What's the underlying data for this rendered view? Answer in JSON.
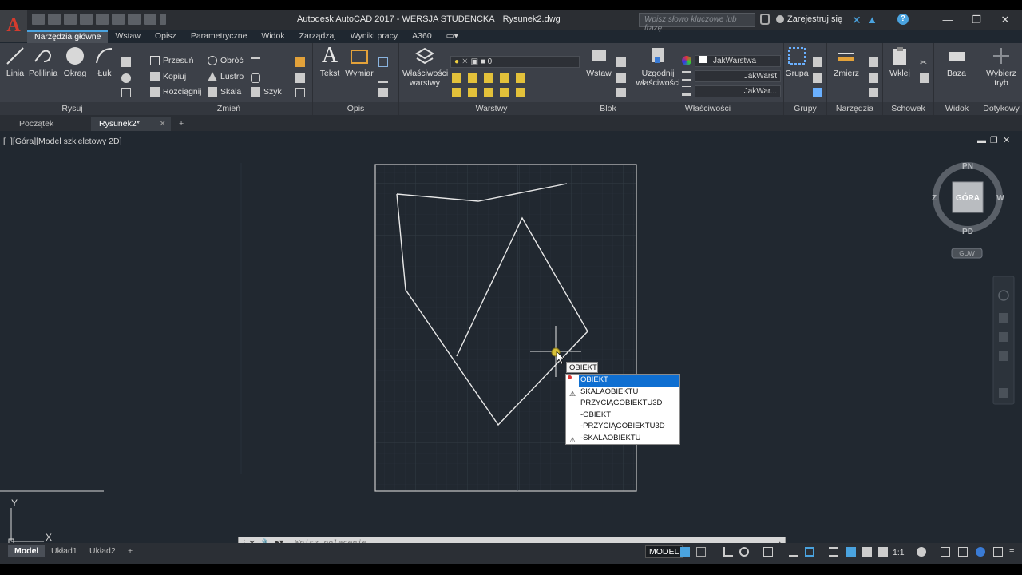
{
  "titlebar": {
    "app_title": "Autodesk AutoCAD 2017 - WERSJA STUDENCKA",
    "file_name": "Rysunek2.dwg",
    "search_placeholder": "Wpisz słowo kluczowe lub frazę",
    "signin_label": "Zarejestruj się",
    "logo_letter": "A"
  },
  "ribbon_tabs": [
    "Narzędzia główne",
    "Wstaw",
    "Opisz",
    "Parametryczne",
    "Widok",
    "Zarządzaj",
    "Wyniki pracy",
    "A360"
  ],
  "ribbon": {
    "draw": {
      "title": "Rysuj",
      "line": "Linia",
      "polyline": "Polilinia",
      "circle": "Okrąg",
      "arc": "Łuk"
    },
    "modify": {
      "title": "Zmień",
      "move": "Przesuń",
      "rotate": "Obróć",
      "copy": "Kopiuj",
      "mirror": "Lustro",
      "stretch": "Rozciągnij",
      "scale": "Skala",
      "array": "Szyk"
    },
    "annotation": {
      "title": "Opis",
      "text": "Tekst",
      "dimension": "Wymiar"
    },
    "layers": {
      "title": "Warstwy",
      "props": "Właściwości",
      "props2": "warstwy",
      "current_layer": "0"
    },
    "block": {
      "title": "Blok",
      "insert": "Wstaw"
    },
    "properties": {
      "title": "Właściwości",
      "match": "Uzgodnij",
      "match2": "właściwości",
      "color": "JakWarstwa",
      "linetype": "JakWarst",
      "lineweight": "JakWar..."
    },
    "groups": {
      "title": "Grupy",
      "group": "Grupa"
    },
    "utilities": {
      "title": "Narzędzia",
      "measure": "Zmierz"
    },
    "clipboard": {
      "title": "Schowek",
      "paste": "Wklej"
    },
    "view": {
      "title": "Widok",
      "base": "Baza"
    },
    "touch": {
      "title": "Dotykowy",
      "select_mode": "Wybierz",
      "select_mode2": "tryb"
    }
  },
  "file_tabs": [
    "Początek",
    "Rysunek2*"
  ],
  "viewport": {
    "label": "[−][Góra][Model szkieletowy 2D]",
    "viewcube": {
      "top": "GÓRA",
      "north": "PN",
      "south": "PD",
      "east": "W",
      "west": "Z",
      "ucs": "GUW"
    },
    "ucs_x": "X",
    "ucs_y": "Y"
  },
  "command": {
    "typed": "OBIEKT",
    "suggestions": [
      "OBIEKT",
      "SKALAOBIEKTU",
      "PRZYCIĄGOBIEKTU3D",
      "-OBIEKT",
      "-PRZYCIĄGOBIEKTU3D",
      "-SKALAOBIEKTU"
    ],
    "placeholder": "Wpisz polecenie"
  },
  "status": {
    "layout_tabs": [
      "Model",
      "Układ1",
      "Układ2"
    ],
    "model_label": "MODEL",
    "scale": "1:1"
  },
  "colors": {
    "accent": "#0f6fd1",
    "viewport_bg": "#212830",
    "ribbon_bg": "#3c4048",
    "logo_red": "#d43b2e"
  }
}
